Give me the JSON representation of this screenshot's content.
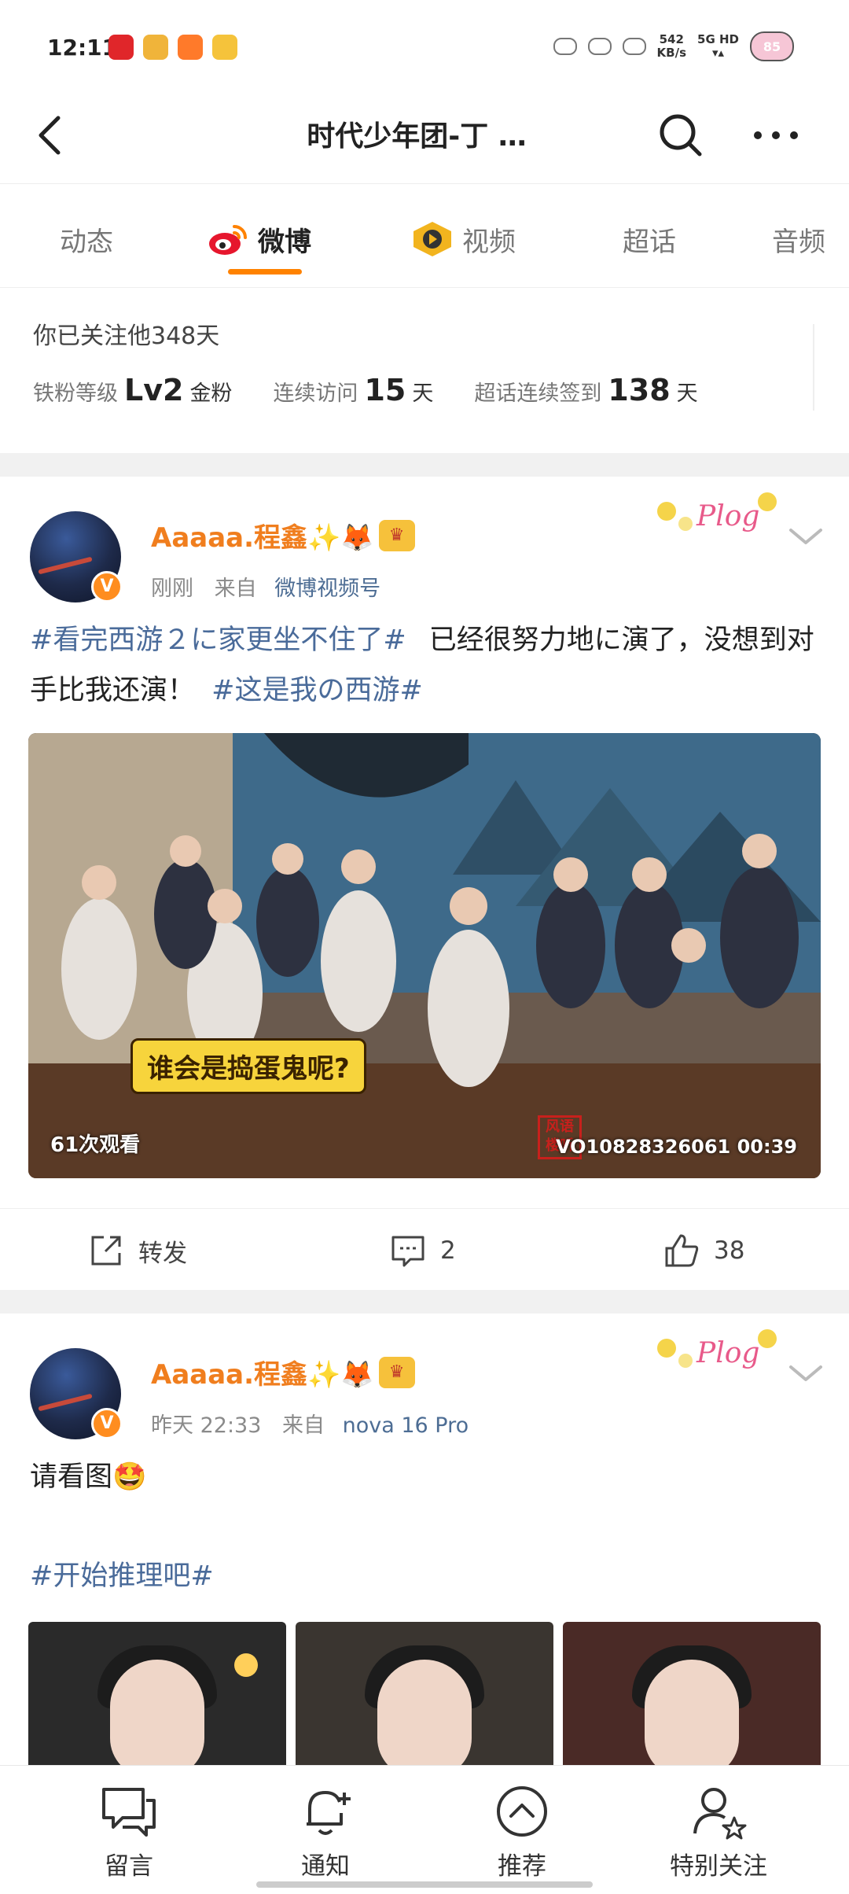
{
  "status_bar": {
    "time": "12:11",
    "net_speed_top": "542",
    "net_speed_bottom": "KB/s",
    "network_top": "5G HD",
    "battery": "85"
  },
  "header": {
    "title": "时代少年团-丁 …",
    "icons": [
      "back-icon",
      "search-icon",
      "more-icon"
    ]
  },
  "tabs": [
    {
      "label": "动态"
    },
    {
      "label": "微博",
      "active": true
    },
    {
      "label": "视频"
    },
    {
      "label": "超话"
    },
    {
      "label": "音频"
    }
  ],
  "fan_info": {
    "follow_text": "你已关注他348天",
    "level_label": "铁粉等级",
    "level_value": "Lv2",
    "level_unit": "金粉",
    "visit_label": "连续访问",
    "visit_value": "15",
    "visit_unit": "天",
    "checkin_label": "超话连续签到",
    "checkin_value": "138",
    "checkin_unit": "天"
  },
  "posts": [
    {
      "username": "Aaaaa.程鑫✨🦊",
      "verified": "V",
      "badge": "Plog",
      "time": "刚刚",
      "from_label": "来自",
      "source": "微博视频号",
      "topic1": "#看完西游２に家更坐不住了#",
      "text1": "已经很努力地に演了，没想到对手比我还演！",
      "topic2": "#这是我の西游#",
      "video": {
        "views": "61次观看",
        "code": "VO10828326061",
        "duration": "00:39",
        "caption": "谁会是捣蛋鬼呢?",
        "stamp": "风语楼听"
      },
      "actions": {
        "repost_label": "转发",
        "comments": "2",
        "likes": "38"
      }
    },
    {
      "username": "Aaaaa.程鑫✨🦊",
      "verified": "V",
      "badge": "Plog",
      "time": "昨天 22:33",
      "from_label": "来自",
      "source": "nova 16 Pro",
      "text1": "请看图🤩",
      "topic1": "#开始推理吧#"
    }
  ],
  "bottom_bar": [
    {
      "label": "留言",
      "icon": "message-icon"
    },
    {
      "label": "通知",
      "icon": "bell-plus-icon"
    },
    {
      "label": "推荐",
      "icon": "up-circle-icon"
    },
    {
      "label": "特别关注",
      "icon": "user-star-icon"
    }
  ],
  "colors": {
    "accent": "#ff8200",
    "username": "#f07e1e",
    "topic": "#4a6b9a"
  }
}
